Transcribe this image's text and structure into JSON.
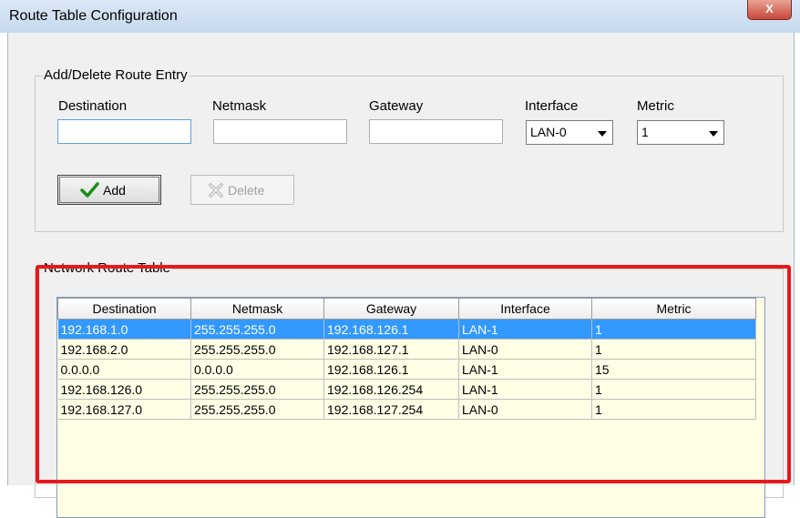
{
  "window": {
    "title": "Route Table Configuration",
    "close_label": "X"
  },
  "entry_group": {
    "title": "Add/Delete Route Entry",
    "fields": {
      "destination": {
        "label": "Destination",
        "value": ""
      },
      "netmask": {
        "label": "Netmask",
        "value": ""
      },
      "gateway": {
        "label": "Gateway",
        "value": ""
      },
      "interface": {
        "label": "Interface",
        "value": "LAN-0"
      },
      "metric": {
        "label": "Metric",
        "value": "1"
      }
    },
    "add_label": "Add",
    "delete_label": "Delete"
  },
  "route_group": {
    "title": "Network Route Table",
    "columns": [
      "Destination",
      "Netmask",
      "Gateway",
      "Interface",
      "Metric"
    ],
    "rows": [
      [
        "192.168.1.0",
        "255.255.255.0",
        "192.168.126.1",
        "LAN-1",
        "1"
      ],
      [
        "192.168.2.0",
        "255.255.255.0",
        "192.168.127.1",
        "LAN-0",
        "1"
      ],
      [
        "0.0.0.0",
        "0.0.0.0",
        "192.168.126.1",
        "LAN-1",
        "15"
      ],
      [
        "192.168.126.0",
        "255.255.255.0",
        "192.168.126.254",
        "LAN-1",
        "1"
      ],
      [
        "192.168.127.0",
        "255.255.255.0",
        "192.168.127.254",
        "LAN-0",
        "1"
      ]
    ],
    "selected_row": 0
  },
  "colors": {
    "selection": "#3399ff",
    "table_background": "#ffffe6",
    "highlight_border": "#e8181c"
  }
}
